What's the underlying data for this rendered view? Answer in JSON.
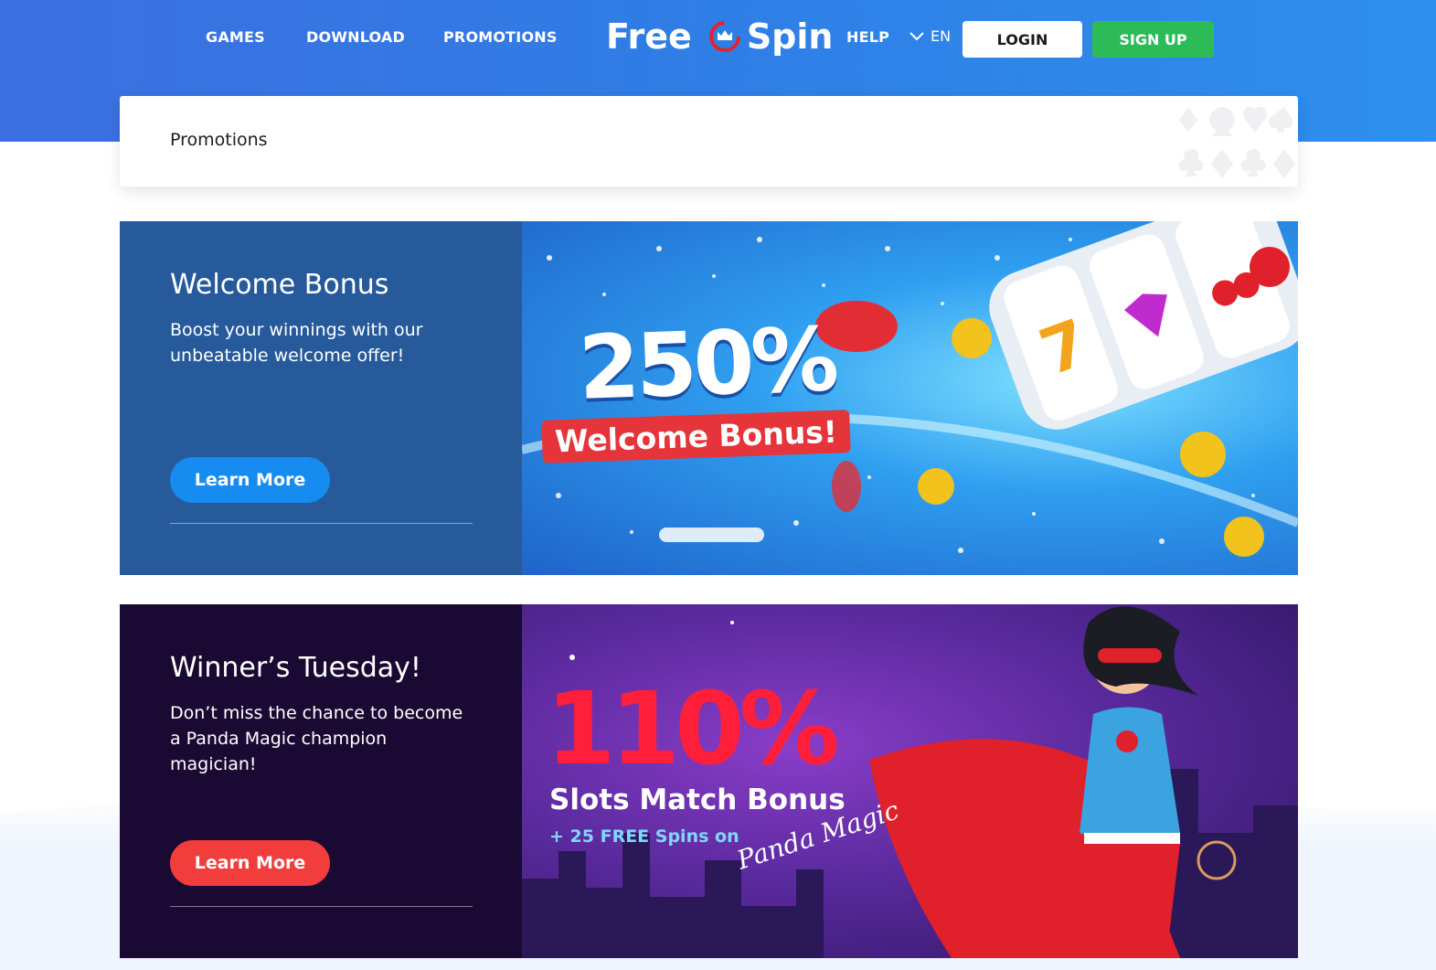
{
  "header": {
    "nav": [
      "GAMES",
      "DOWNLOAD",
      "PROMOTIONS"
    ],
    "logo": {
      "left": "Free",
      "right": "Spin"
    },
    "help": "HELP",
    "language": "EN",
    "login": "LOGIN",
    "signup": "SIGN UP"
  },
  "page": {
    "title": "Promotions"
  },
  "promotions": [
    {
      "title": "Welcome Bonus",
      "description": "Boost your winnings with our unbeatable welcome offer!",
      "button": "Learn More",
      "banner": {
        "headline": "250%",
        "caption": "Welcome Bonus!"
      }
    },
    {
      "title": "Winner’s Tuesday!",
      "description": "Don’t miss the chance to become a Panda Magic champion magician!",
      "button": "Learn More",
      "banner": {
        "headline": "110%",
        "caption": "Slots Match Bonus",
        "extra": "+ 25 FREE Spins on",
        "game": "Panda Magic"
      }
    }
  ],
  "colors": {
    "accent": "#2dbb58",
    "primary": "#2f7ee6",
    "promo1_button": "#168bf0",
    "promo2_button": "#f23d3d"
  }
}
